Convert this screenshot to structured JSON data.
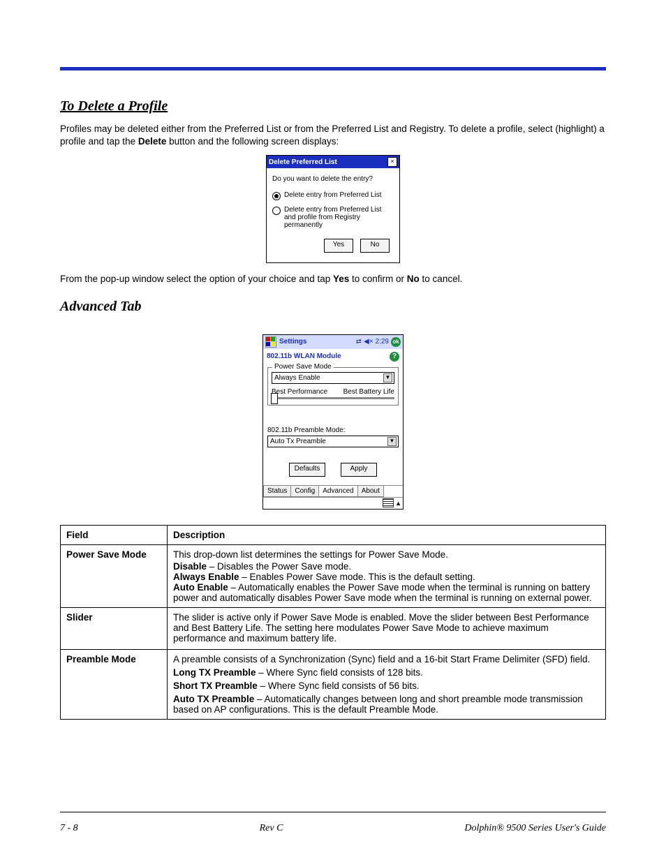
{
  "section1": {
    "title": "To Delete a Profile",
    "intro_pre": "Profiles may be deleted either from the Preferred List or from the Preferred List and Registry. To delete a profile, select (highlight) a profile and tap the ",
    "intro_bold": "Delete",
    "intro_post": " button and the following screen displays:",
    "dialog": {
      "title": "Delete Preferred List",
      "question": "Do you want to delete the entry?",
      "opt1": "Delete entry from Preferred List",
      "opt2": "Delete entry from Preferred List and profile from Registry permanently",
      "yes": "Yes",
      "no": "No"
    },
    "post_pre": "From the pop-up window select the option of your choice and tap ",
    "post_yes": "Yes",
    "post_mid": " to confirm or ",
    "post_no": "No",
    "post_end": " to cancel."
  },
  "section2": {
    "title": "Advanced Tab",
    "shot": {
      "settings": "Settings",
      "time": "2:29",
      "ok": "ok",
      "module": "802.11b WLAN Module",
      "help": "?",
      "psm_legend": "Power Save Mode",
      "psm_value": "Always Enable",
      "best_perf": "Best Performance",
      "best_batt": "Best Battery Life",
      "pre_label": "802.11b Preamble Mode:",
      "pre_value": "Auto Tx Preamble",
      "defaults": "Defaults",
      "apply": "Apply",
      "tabs": [
        "Status",
        "Config",
        "Advanced",
        "About"
      ]
    }
  },
  "table": {
    "h_field": "Field",
    "h_desc": "Description",
    "rows": [
      {
        "field": "Power Save Mode",
        "lead": "This drop-down list determines the settings for Power Save Mode.",
        "items": [
          {
            "b": "Disable",
            "t": " – Disables the Power Save mode."
          },
          {
            "b": "Always Enable",
            "t": " – Enables Power Save mode. This is the default setting."
          },
          {
            "b": "Auto Enable",
            "t": " – Automatically enables the Power Save mode when the terminal is running on battery power and automatically disables Power Save mode when the terminal is running on external power."
          }
        ]
      },
      {
        "field": "Slider",
        "lead": "The slider is active only if Power Save Mode is enabled. Move the slider between Best Performance and Best Battery Life. The setting here modulates Power Save Mode to achieve maximum performance and maximum battery life.",
        "items": []
      },
      {
        "field": "Preamble Mode",
        "lead": "A preamble consists of a Synchronization (Sync) field and a 16-bit Start Frame Delimiter (SFD) field.",
        "items": [
          {
            "b": "Long TX Preamble",
            "t": " – Where Sync field consists of 128 bits."
          },
          {
            "b": "Short TX Preamble",
            "t": " – Where Sync field consists of 56 bits."
          },
          {
            "b": "Auto TX Preamble",
            "t": " – Automatically changes between long and short preamble mode transmission based on AP configurations. This is the default Preamble Mode."
          }
        ]
      }
    ]
  },
  "footer": {
    "left": "7 - 8",
    "mid": "Rev C",
    "right": "Dolphin® 9500 Series User's Guide"
  }
}
